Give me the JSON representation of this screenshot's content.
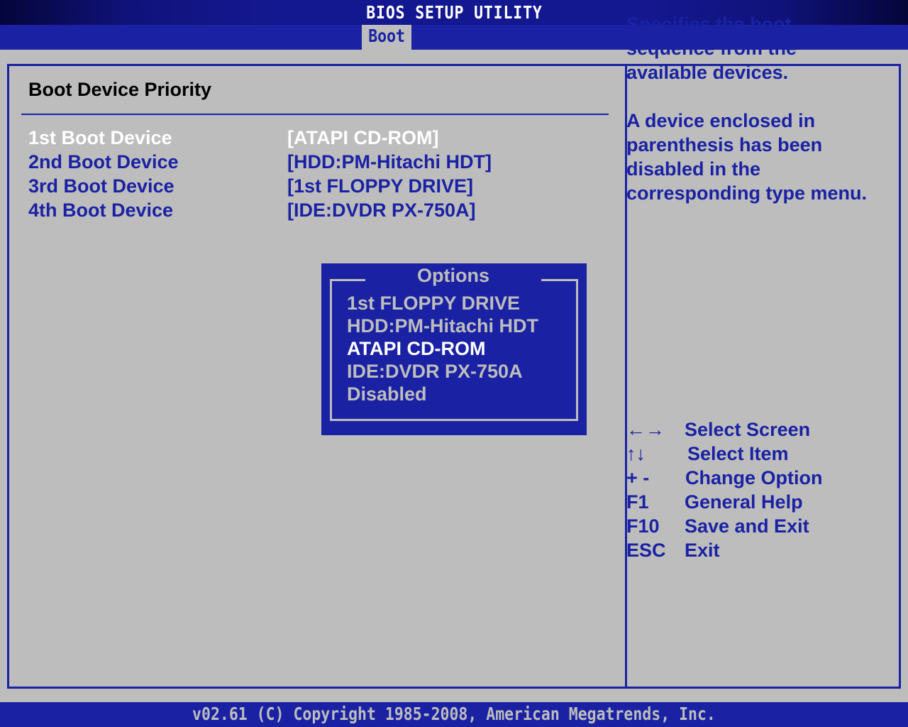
{
  "title": "BIOS SETUP UTILITY",
  "tabs": [
    {
      "label": "Boot",
      "active": true
    }
  ],
  "main": {
    "section_title": "Boot Device Priority",
    "settings": [
      {
        "label": "1st Boot Device",
        "value": "[ATAPI CD-ROM]",
        "selected": true
      },
      {
        "label": "2nd Boot Device",
        "value": "[HDD:PM-Hitachi HDT]",
        "selected": false
      },
      {
        "label": "3rd Boot Device",
        "value": "[1st FLOPPY DRIVE]",
        "selected": false
      },
      {
        "label": "4th Boot Device",
        "value": "[IDE:DVDR PX-750A]",
        "selected": false
      }
    ]
  },
  "options_popup": {
    "title": "Options",
    "items": [
      {
        "label": "1st FLOPPY DRIVE",
        "selected": false
      },
      {
        "label": "HDD:PM-Hitachi HDT",
        "selected": false
      },
      {
        "label": "ATAPI CD-ROM",
        "selected": true
      },
      {
        "label": "IDE:DVDR PX-750A",
        "selected": false
      },
      {
        "label": "Disabled",
        "selected": false
      }
    ]
  },
  "help": {
    "paragraphs": [
      "Specifies the boot sequence from the available devices.",
      "A device enclosed in parenthesis has been disabled in the corresponding type menu."
    ]
  },
  "keys": [
    {
      "key": "←→",
      "icon": "left-right-arrows-icon",
      "desc": "Select Screen"
    },
    {
      "key": "↑↓",
      "icon": "up-down-arrows-icon",
      "desc": "Select Item"
    },
    {
      "key": "+ -",
      "desc": "Change Option"
    },
    {
      "key": "F1",
      "desc": "General Help"
    },
    {
      "key": "F10",
      "desc": "Save and Exit"
    },
    {
      "key": "ESC",
      "desc": "Exit"
    }
  ],
  "footer": "v02.61 (C) Copyright 1985-2008, American Megatrends, Inc.",
  "colors": {
    "accent_blue": "#1a22a3",
    "background_gray": "#bdbdbd",
    "highlight_white": "#ffffff"
  }
}
